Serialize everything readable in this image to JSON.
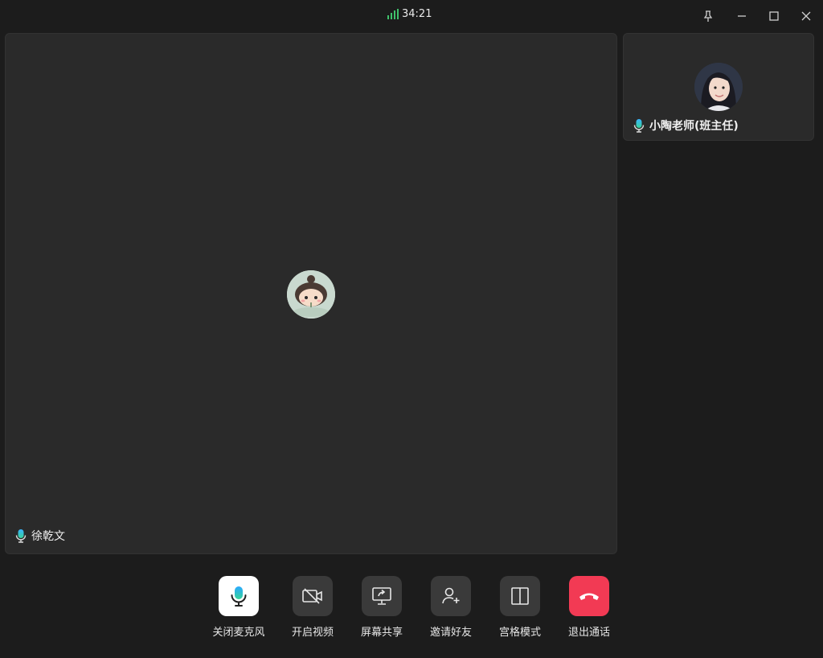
{
  "titlebar": {
    "call_duration": "34:21",
    "signal_color": "#3fc26b",
    "controls": [
      "pin-icon",
      "minimize-icon",
      "maximize-icon",
      "close-icon"
    ]
  },
  "main_participant": {
    "name": "徐乾文",
    "mic_icon": "microphone-icon",
    "avatar_bg": "#c9d9cf"
  },
  "side_participant": {
    "name": "小陶老师(班主任)",
    "mic_icon": "microphone-icon"
  },
  "toolbar": {
    "mute_label": "关闭麦克风",
    "video_label": "开启视频",
    "share_label": "屏幕共享",
    "invite_label": "邀请好友",
    "grid_label": "宫格模式",
    "exit_label": "退出通话",
    "exit_color": "#f23a54"
  }
}
